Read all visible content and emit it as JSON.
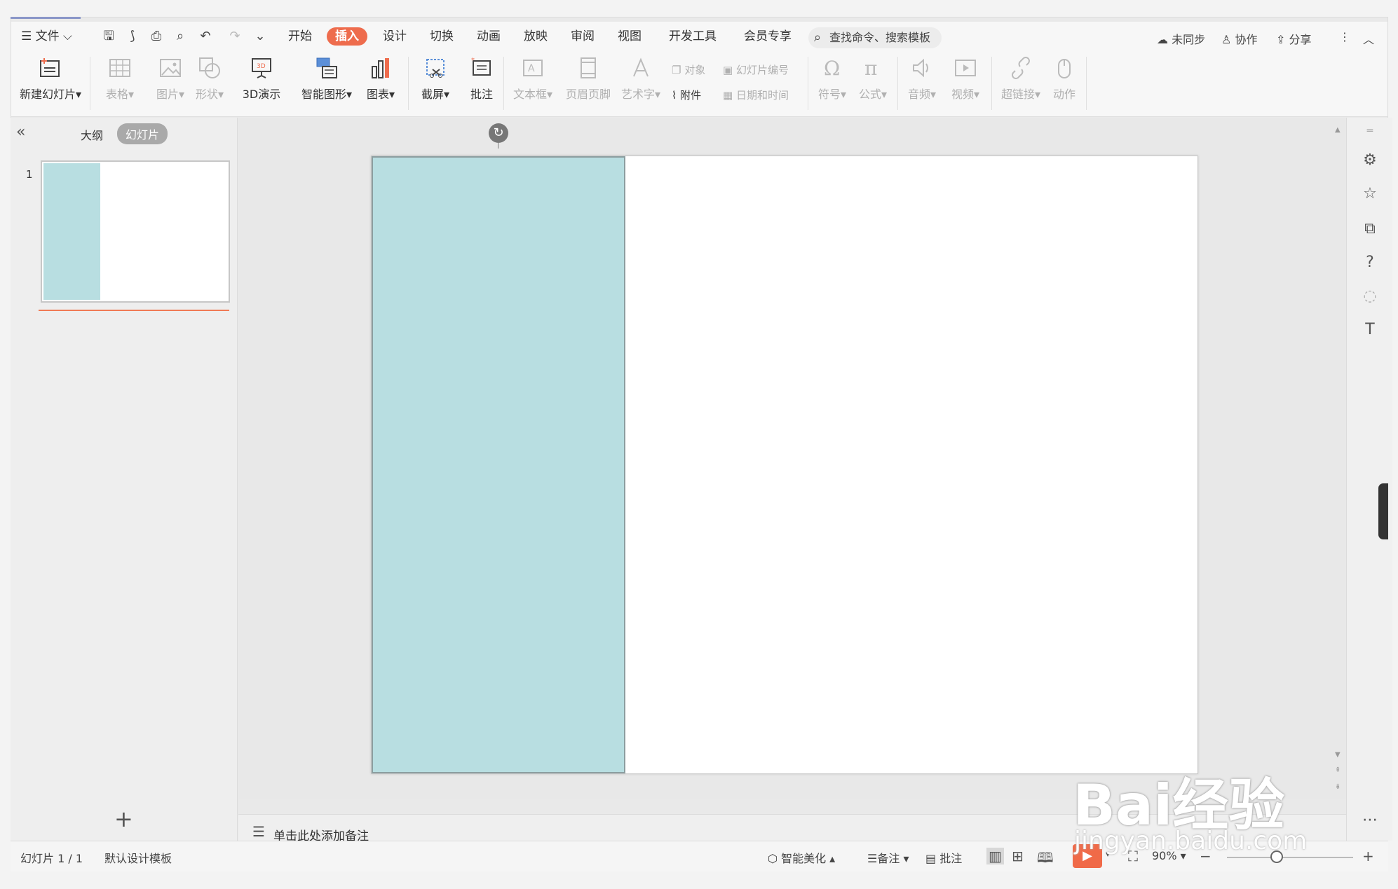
{
  "menu": {
    "file": "文件",
    "tabs": [
      "开始",
      "插入",
      "设计",
      "切换",
      "动画",
      "放映",
      "审阅",
      "视图",
      "开发工具",
      "会员专享"
    ],
    "active_tab": "插入",
    "search_placeholder": "查找命令、搜索模板",
    "sync": "未同步",
    "collab": "协作",
    "share": "分享"
  },
  "ribbon": {
    "new_slide": "新建幻灯片",
    "table": "表格",
    "picture": "图片",
    "shape": "形状",
    "demo3d": "3D演示",
    "smartart": "智能图形",
    "chart": "图表",
    "screenshot": "截屏",
    "comment": "批注",
    "textbox": "文本框",
    "header_footer": "页眉页脚",
    "wordart": "艺术字",
    "object": "对象",
    "slide_number": "幻灯片编号",
    "attachment": "附件",
    "date_time": "日期和时间",
    "symbol": "符号",
    "formula": "公式",
    "audio": "音频",
    "video": "视频",
    "hyperlink": "超链接",
    "action": "动作"
  },
  "left_panel": {
    "tab_outline": "大纲",
    "tab_slides": "幻灯片",
    "slide_number": "1"
  },
  "notes": {
    "placeholder": "单击此处添加备注"
  },
  "status": {
    "slide_info": "幻灯片 1 / 1",
    "template": "默认设计模板",
    "beautify": "智能美化",
    "notes": "备注",
    "comment": "批注",
    "zoom": "90%"
  },
  "colors": {
    "accent": "#ee6c4d",
    "teal_shape": "#b8dee1"
  },
  "watermark": {
    "text": "Bai经验",
    "url": "jingyan.baidu.com"
  }
}
